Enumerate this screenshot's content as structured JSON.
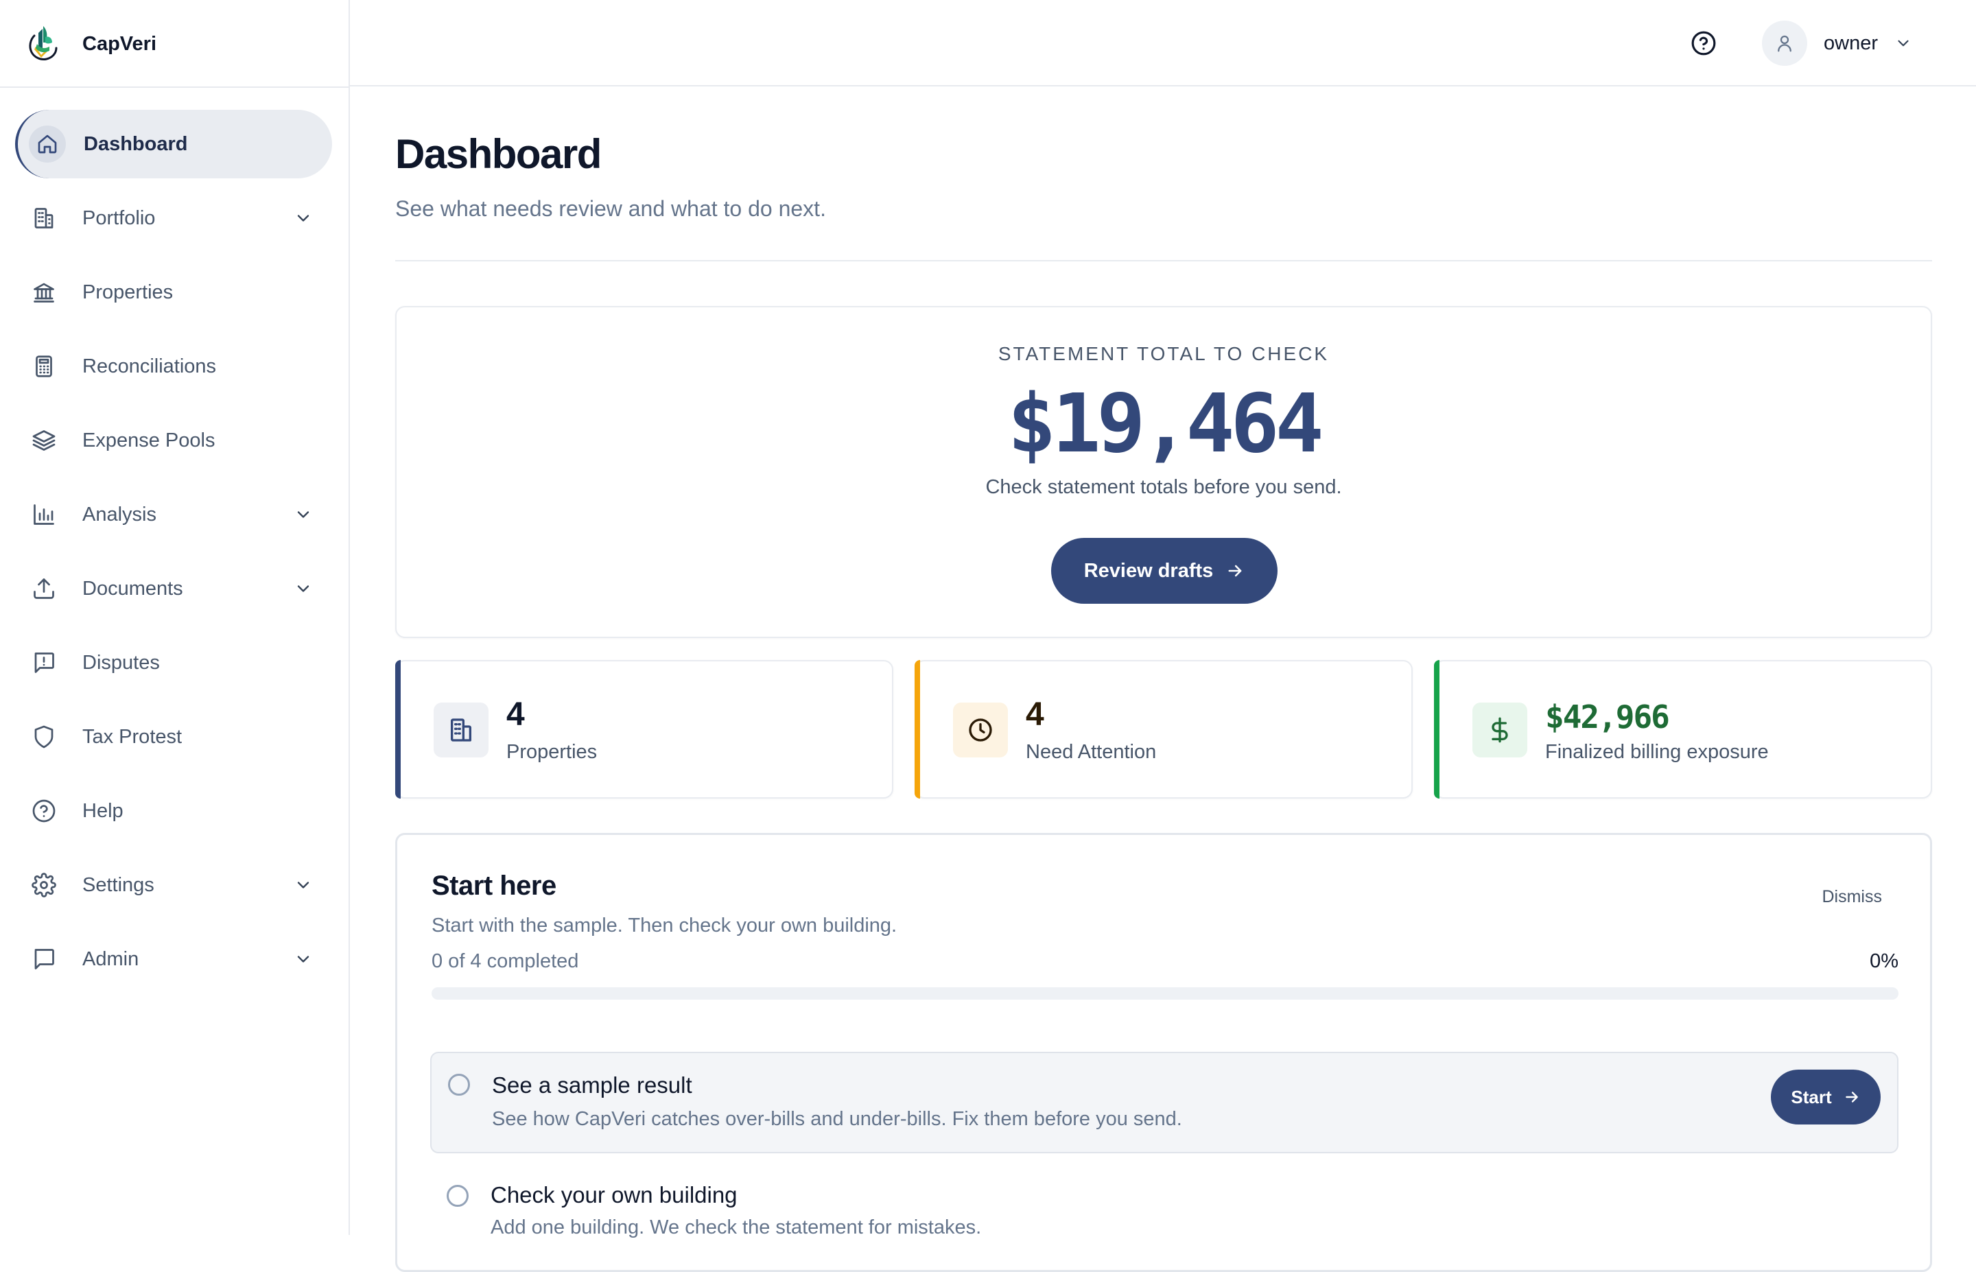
{
  "app": {
    "name": "CapVeri"
  },
  "icons": {
    "logo": "capveri-logo",
    "help": "help-circle-icon",
    "user": "user-icon",
    "chevron": "chevron-down-icon",
    "arrow": "arrow-right-icon"
  },
  "colors": {
    "primary": "#33487a",
    "attention": "#f5a50b",
    "success": "#16a34a",
    "money_text": "#1e6b35"
  },
  "sidebar": {
    "items": [
      {
        "label": "Dashboard",
        "icon": "home-icon",
        "active": true,
        "expandable": false
      },
      {
        "label": "Portfolio",
        "icon": "building-icon",
        "active": false,
        "expandable": true
      },
      {
        "label": "Properties",
        "icon": "bank-icon",
        "active": false,
        "expandable": false
      },
      {
        "label": "Reconciliations",
        "icon": "calculator-icon",
        "active": false,
        "expandable": false
      },
      {
        "label": "Expense Pools",
        "icon": "layers-icon",
        "active": false,
        "expandable": false
      },
      {
        "label": "Analysis",
        "icon": "bar-chart-icon",
        "active": false,
        "expandable": true
      },
      {
        "label": "Documents",
        "icon": "upload-icon",
        "active": false,
        "expandable": true
      },
      {
        "label": "Disputes",
        "icon": "message-alert-icon",
        "active": false,
        "expandable": false
      },
      {
        "label": "Tax Protest",
        "icon": "shield-icon",
        "active": false,
        "expandable": false
      },
      {
        "label": "Help",
        "icon": "help-circle-icon",
        "active": false,
        "expandable": false
      },
      {
        "label": "Settings",
        "icon": "gear-icon",
        "active": false,
        "expandable": true
      },
      {
        "label": "Admin",
        "icon": "message-square-icon",
        "active": false,
        "expandable": true
      }
    ]
  },
  "header": {
    "user_name": "owner"
  },
  "page": {
    "title": "Dashboard",
    "subtitle": "See what needs review and what to do next."
  },
  "hero": {
    "label": "STATEMENT TOTAL TO CHECK",
    "value": "$19,464",
    "note": "Check statement totals before you send.",
    "button": "Review drafts"
  },
  "stats": [
    {
      "value": "4",
      "label": "Properties",
      "icon": "building-icon"
    },
    {
      "value": "4",
      "label": "Need Attention",
      "icon": "clock-icon"
    },
    {
      "value": "$42,966",
      "label": "Finalized billing exposure",
      "icon": "dollar-icon"
    }
  ],
  "onboarding": {
    "title": "Start here",
    "dismiss": "Dismiss",
    "subtitle": "Start with the sample. Then check your own building.",
    "progress_text": "0 of 4 completed",
    "progress_label": "0%",
    "progress_fraction": 0,
    "tasks": [
      {
        "title": "See a sample result",
        "desc": "See how CapVeri catches over-bills and under-bills. Fix them before you send.",
        "button": "Start"
      },
      {
        "title": "Check your own building",
        "desc": "Add one building. We check the statement for mistakes."
      }
    ]
  }
}
